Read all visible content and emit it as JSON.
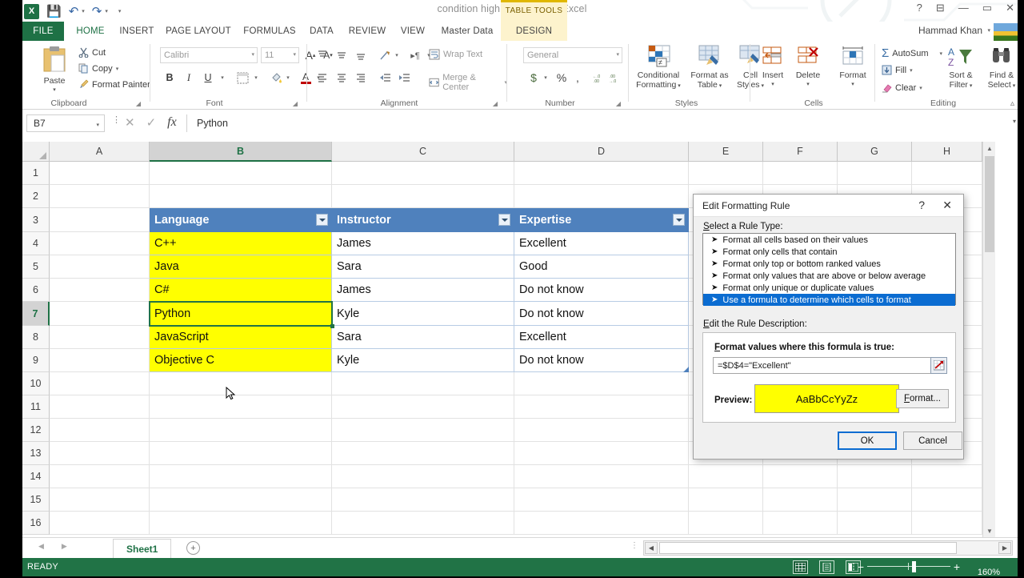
{
  "window": {
    "document_title": "condition highlighting.xlsx - Excel",
    "contextual_tab_group": "TABLE TOOLS",
    "user_name": "Hammad Khan",
    "help_icon": "?",
    "ribbon_display_icon": "ribbon-display-options",
    "minimize_icon": "—",
    "restore_icon": "▭",
    "close_icon": "✕"
  },
  "quick_access": {
    "app_logo": "excel-logo",
    "logo_text": "X",
    "save_icon": "save-icon",
    "undo_icon": "undo-icon",
    "redo_icon": "redo-icon",
    "customize_icon": "customize-qat-icon"
  },
  "ribbon_tabs": [
    {
      "label": "FILE",
      "active": false
    },
    {
      "label": "HOME",
      "active": true
    },
    {
      "label": "INSERT",
      "active": false
    },
    {
      "label": "PAGE LAYOUT",
      "active": false
    },
    {
      "label": "FORMULAS",
      "active": false
    },
    {
      "label": "DATA",
      "active": false
    },
    {
      "label": "REVIEW",
      "active": false
    },
    {
      "label": "VIEW",
      "active": false
    },
    {
      "label": "Master Data",
      "active": false
    },
    {
      "label": "DESIGN",
      "active": false
    }
  ],
  "ribbon": {
    "clipboard": {
      "group_label": "Clipboard",
      "paste": "Paste",
      "cut": "Cut",
      "copy": "Copy",
      "format_painter": "Format Painter"
    },
    "font": {
      "group_label": "Font",
      "font_name": "Calibri",
      "font_size": "11",
      "grow_font": "A",
      "shrink_font": "A",
      "bold": "B",
      "italic": "I",
      "underline": "U",
      "borders_icon": "borders-icon",
      "fill_color_icon": "fill-color-icon",
      "font_color": "A"
    },
    "alignment": {
      "group_label": "Alignment",
      "wrap_text": "Wrap Text",
      "merge_center": "Merge & Center"
    },
    "number": {
      "group_label": "Number",
      "format": "General",
      "currency": "$",
      "percent": "%",
      "comma": ",",
      "increase_decimal": ".00",
      "decrease_decimal": ".00"
    },
    "styles": {
      "group_label": "Styles",
      "conditional_formatting": "Conditional\nFormatting",
      "conditional_formatting_l1": "Conditional",
      "conditional_formatting_l2": "Formatting",
      "format_as_table_l1": "Format as",
      "format_as_table_l2": "Table",
      "cell_styles_l1": "Cell",
      "cell_styles_l2": "Styles"
    },
    "cells": {
      "group_label": "Cells",
      "insert": "Insert",
      "delete": "Delete",
      "format": "Format"
    },
    "editing": {
      "group_label": "Editing",
      "autosum": "AutoSum",
      "fill": "Fill",
      "clear": "Clear",
      "sort_filter_l1": "Sort &",
      "sort_filter_l2": "Filter",
      "find_select_l1": "Find &",
      "find_select_l2": "Select",
      "collapse_ribbon_icon": "collapse-ribbon-icon"
    }
  },
  "formula_bar": {
    "name_box_value": "B7",
    "cancel_icon": "✕",
    "enter_icon": "✓",
    "function_icon": "fx",
    "value": "Python"
  },
  "grid": {
    "column_headers": [
      "A",
      "B",
      "C",
      "D",
      "E",
      "F",
      "G",
      "H"
    ],
    "selected_column": "B",
    "row_headers": [
      "1",
      "2",
      "3",
      "4",
      "5",
      "6",
      "7",
      "8",
      "9",
      "10",
      "11",
      "12",
      "13",
      "14",
      "15",
      "16"
    ],
    "selected_row": "7",
    "table_headers": [
      "Language",
      "Instructor",
      "Expertise"
    ],
    "rows": [
      {
        "language": "C++",
        "instructor": "James",
        "expertise": "Excellent",
        "highlight": true
      },
      {
        "language": "Java",
        "instructor": "Sara",
        "expertise": "Good",
        "highlight": true
      },
      {
        "language": "C#",
        "instructor": "James",
        "expertise": "Do not know",
        "highlight": true
      },
      {
        "language": "Python",
        "instructor": "Kyle",
        "expertise": "Do not know",
        "highlight": true
      },
      {
        "language": "JavaScript",
        "instructor": "Sara",
        "expertise": "Excellent",
        "highlight": true
      },
      {
        "language": "Objective C",
        "instructor": "Kyle",
        "expertise": "Do not know",
        "highlight": true
      }
    ],
    "active_cell": "B7",
    "filter_icon": "filter-dropdown-icon",
    "colors": {
      "table_header_blue": "#4F81BD",
      "highlight_yellow": "#FFFF00",
      "selection_green": "#217346"
    }
  },
  "dialog": {
    "title": "Edit Formatting Rule",
    "help_icon": "?",
    "close_icon": "✕",
    "rule_type_label": "Select a Rule Type:",
    "rule_types": [
      {
        "label": "Format all cells based on their values",
        "selected": false
      },
      {
        "label": "Format only cells that contain",
        "selected": false
      },
      {
        "label": "Format only top or bottom ranked values",
        "selected": false
      },
      {
        "label": "Format only values that are above or below average",
        "selected": false
      },
      {
        "label": "Format only unique or duplicate values",
        "selected": false
      },
      {
        "label": "Use a formula to determine which cells to format",
        "selected": true
      }
    ],
    "rule_description_label": "Edit the Rule Description:",
    "formula_label": "Format values where this formula is true:",
    "formula_value": "=$D$4=\"Excellent\"",
    "range_picker_icon": "range-selector-icon",
    "preview_label": "Preview:",
    "preview_text": "AaBbCcYyZz",
    "preview_fill": "#FFFF00",
    "format_button": "Format...",
    "ok_button": "OK",
    "cancel_button": "Cancel"
  },
  "sheet_bar": {
    "prev_icon": "◀",
    "next_icon": "▶",
    "sheets": [
      "Sheet1"
    ],
    "active_sheet": "Sheet1",
    "add_sheet_icon": "+"
  },
  "status_bar": {
    "status": "READY",
    "view_normal_icon": "normal-view-icon",
    "view_pagelayout_icon": "page-layout-view-icon",
    "view_pagebreak_icon": "page-break-preview-icon",
    "zoom_out_icon": "−",
    "zoom_in_icon": "+",
    "zoom_level": "160%"
  }
}
